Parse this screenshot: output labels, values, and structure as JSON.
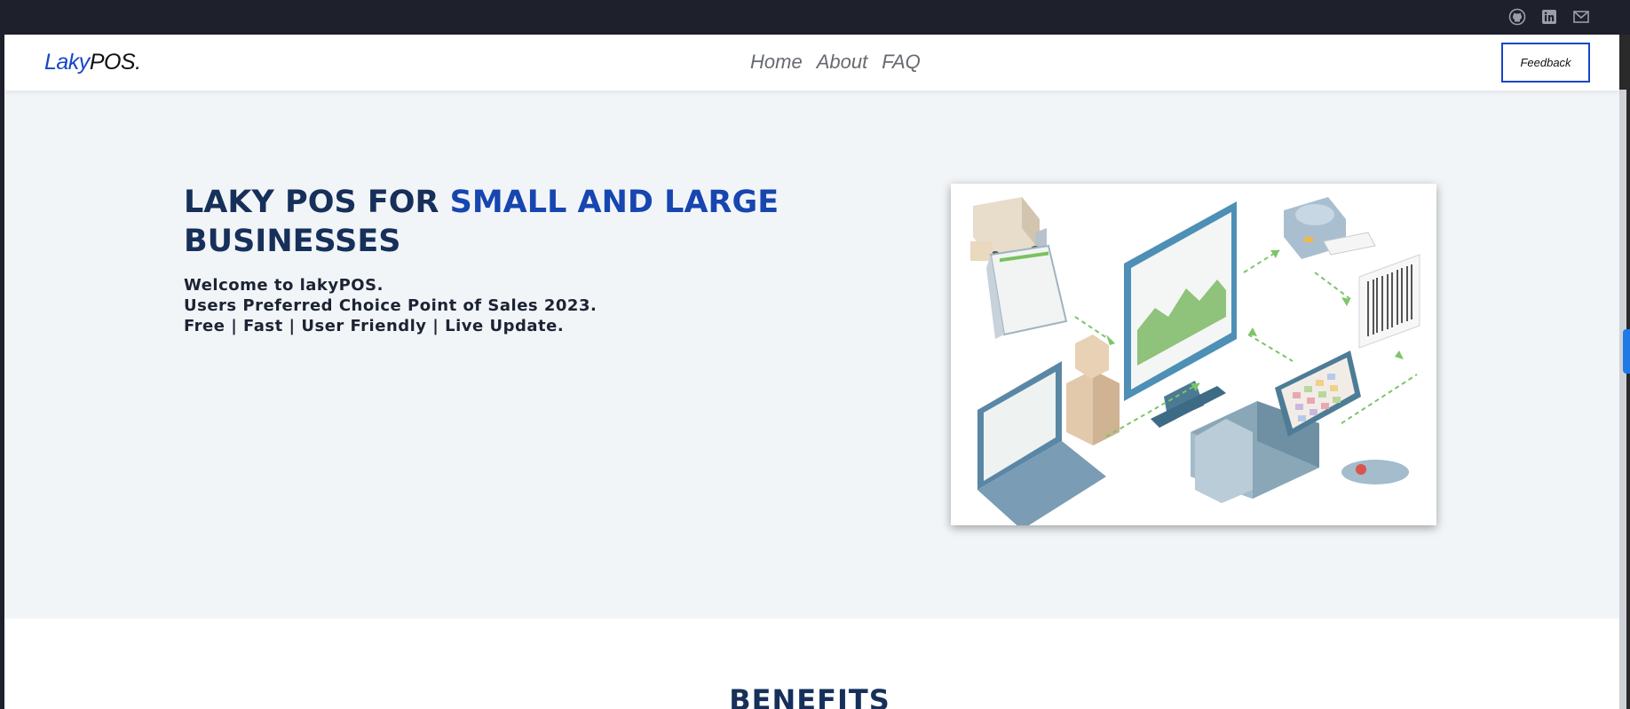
{
  "topbar": {
    "icons": [
      "github-icon",
      "linkedin-icon",
      "mail-icon"
    ]
  },
  "navbar": {
    "logo_part1": "Laky",
    "logo_part2": "POS.",
    "links": [
      "Home",
      "About",
      "FAQ"
    ],
    "feedback_label": "Feedback"
  },
  "hero": {
    "title_part1": "LAKY POS FOR ",
    "title_highlight": "SMALL AND LARGE",
    "title_part2": " BUSINESSES",
    "lines": [
      "Welcome to lakyPOS.",
      "Users Preferred Choice Point of Sales 2023.",
      "Free | Fast | User Friendly | Live Update."
    ]
  },
  "benefits": {
    "title": "BENEFITS"
  },
  "colors": {
    "accent": "#1746c8",
    "dark_navy": "#16305a",
    "topbar": "#1e202b",
    "hero_bg": "#f2f5f8"
  }
}
